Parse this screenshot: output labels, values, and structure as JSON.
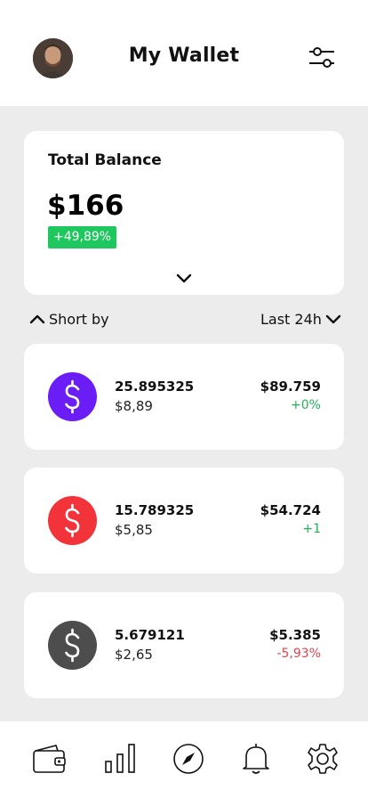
{
  "header": {
    "title": "My Wallet",
    "avatar_icon": "user-avatar",
    "filter_icon": "sliders-icon"
  },
  "balance": {
    "label": "Total Balance",
    "value": "$166",
    "change": "+49,89%",
    "expand_icon": "chevron-down-icon"
  },
  "sort": {
    "label": "Short by",
    "period": "Last 24h"
  },
  "assets": [
    {
      "amount": "25.895325",
      "price": "$8,89",
      "value": "$89.759",
      "change": "+0%",
      "coin_color": "#6a1ef5",
      "change_color": "#1fb358"
    },
    {
      "amount": "15.789325",
      "price": "$5,85",
      "value": "$54.724",
      "change": "+1",
      "coin_color": "#f2333a",
      "change_color": "#1fb358"
    },
    {
      "amount": "5.679121",
      "price": "$2,65",
      "value": "$5.385",
      "change": "-5,93%",
      "coin_color": "#4d4d4d",
      "change_color": "#e0444d"
    }
  ],
  "nav": [
    "wallet-icon",
    "chart-bars-icon",
    "compass-icon",
    "bell-icon",
    "gear-icon"
  ],
  "colors": {
    "positive": "#1fc75f",
    "negative": "#e0444d",
    "background": "#ececec"
  }
}
